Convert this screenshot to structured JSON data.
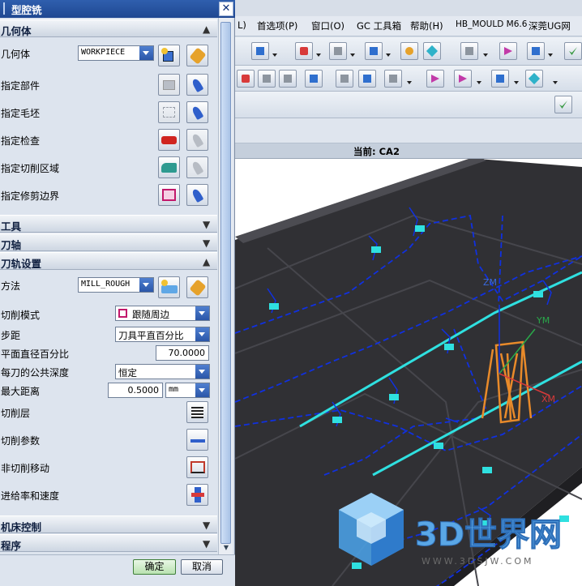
{
  "dialog": {
    "title": "型腔铣",
    "close_label": "✕",
    "sections": {
      "geometry": "几何体",
      "tool": "工具",
      "tool_axis": "刀轴",
      "path_settings": "刀轨设置",
      "machine_control": "机床控制",
      "program": "程序"
    },
    "geometry_rows": {
      "geometry_label": "几何体",
      "geometry_value": "WORKPIECE",
      "part": "指定部件",
      "blank": "指定毛坯",
      "check": "指定检查",
      "cut_area": "指定切削区域",
      "trim": "指定修剪边界"
    },
    "path_rows": {
      "method_label": "方法",
      "method_value": "MILL_ROUGH",
      "cut_pattern_label": "切削模式",
      "cut_pattern_value": "跟随周边",
      "stepover_label": "步距",
      "stepover_value": "刀具平直百分比",
      "flat_diameter_label": "平面直径百分比",
      "flat_diameter_value": "70.0000",
      "depth_per_cut_label": "每刀的公共深度",
      "depth_per_cut_value": "恒定",
      "max_distance_label": "最大距离",
      "max_distance_value": "0.5000",
      "max_distance_unit": "mm",
      "cut_levels": "切削层",
      "cut_params": "切削参数",
      "non_cutting": "非切削移动",
      "feeds_speeds": "进给率和速度"
    },
    "ok_label": "确定",
    "cancel_label": "取消"
  },
  "app": {
    "menu": [
      "L)",
      "首选项(P)",
      "窗口(O)",
      "GC 工具箱",
      "帮助(H)",
      "HB_MOULD M6.6",
      "深莞UG网"
    ],
    "status": "当前: CA2",
    "watermark_title": "3D世界网",
    "watermark_url": "WWW.3DSJW.COM",
    "axes": {
      "zm": "ZM",
      "ym": "YM",
      "xm": "XM"
    }
  },
  "colors": {
    "title_bar": "#1f4791",
    "toolpath_blue": "#1030e0",
    "toolpath_cyan": "#2fe0e0",
    "tool_orange": "#e88a2a",
    "part_dark": "#2e2e32"
  }
}
